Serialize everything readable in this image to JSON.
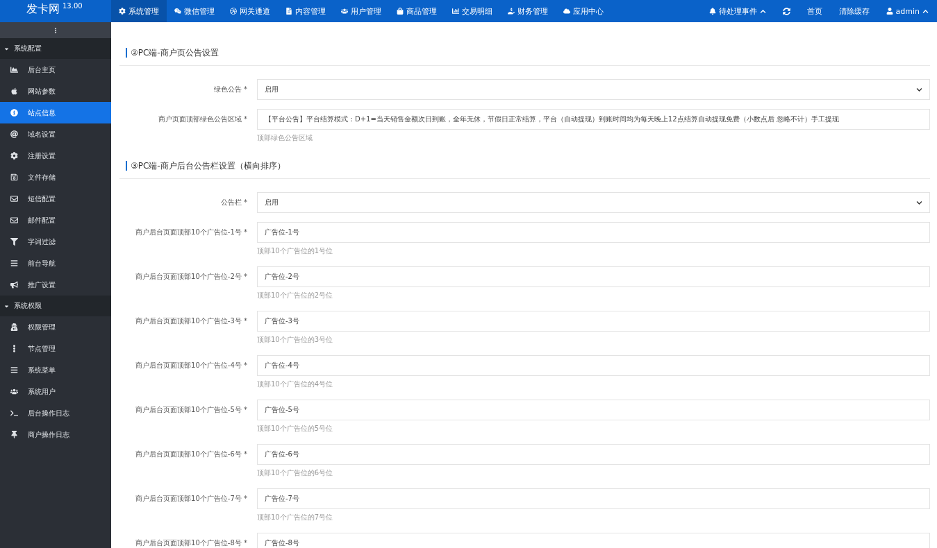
{
  "header": {
    "logo": "发卡网",
    "version": "13.00",
    "nav": [
      {
        "label": "系统管理",
        "selected": true
      },
      {
        "label": "微信管理",
        "selected": false
      },
      {
        "label": "网关通道",
        "selected": false
      },
      {
        "label": "内容管理",
        "selected": false
      },
      {
        "label": "用户管理",
        "selected": false
      },
      {
        "label": "商品管理",
        "selected": false
      },
      {
        "label": "交易明细",
        "selected": false
      },
      {
        "label": "财务管理",
        "selected": false
      },
      {
        "label": "应用中心",
        "selected": false
      }
    ],
    "pending": "待处理事件",
    "home": "首页",
    "clear_cache": "清除缓存",
    "user": "admin"
  },
  "sidebar": {
    "groups": [
      {
        "title": "系统配置",
        "expanded": true,
        "items": [
          {
            "label": "后台主页",
            "selected": false
          },
          {
            "label": "网站参数",
            "selected": false
          },
          {
            "label": "站点信息",
            "selected": true
          },
          {
            "label": "域名设置",
            "selected": false
          },
          {
            "label": "注册设置",
            "selected": false
          },
          {
            "label": "文件存储",
            "selected": false
          },
          {
            "label": "短信配置",
            "selected": false
          },
          {
            "label": "邮件配置",
            "selected": false
          },
          {
            "label": "字词过滤",
            "selected": false
          },
          {
            "label": "前台导航",
            "selected": false
          },
          {
            "label": "推广设置",
            "selected": false
          }
        ]
      },
      {
        "title": "系统权限",
        "expanded": true,
        "items": [
          {
            "label": "权限管理",
            "selected": false
          },
          {
            "label": "节点管理",
            "selected": false
          },
          {
            "label": "系统菜单",
            "selected": false
          },
          {
            "label": "系统用户",
            "selected": false
          },
          {
            "label": "后台操作日志",
            "selected": false
          },
          {
            "label": "商户操作日志",
            "selected": false
          }
        ]
      }
    ]
  },
  "sections": [
    {
      "title": "②PC端-商户页公告设置",
      "fields": [
        {
          "kind": "select",
          "label": "绿色公告",
          "mark": "*",
          "value": "启用"
        },
        {
          "kind": "input",
          "label": "商户页面顶部绿色公告区域",
          "mark": "*",
          "value": "【平台公告】平台结算模式：D+1=当天销售金额次日到账，全年无休，节假日正常结算，平台（自动提现）到账时间均为每天晚上12点结算自动提现免费（小数点后 忽略不计）手工提现",
          "hint": "顶部绿色公告区域"
        }
      ]
    },
    {
      "title": "③PC端-商户后台公告栏设置（横向排序）",
      "fields": [
        {
          "kind": "select",
          "label": "公告栏",
          "mark": "*",
          "value": "启用"
        },
        {
          "kind": "input",
          "label": "商户后台页面顶部10个广告位-1号",
          "mark": "*",
          "value": "广告位-1号",
          "hint": "顶部10个广告位的1号位"
        },
        {
          "kind": "input",
          "label": "商户后台页面顶部10个广告位-2号",
          "mark": "*",
          "value": "广告位-2号",
          "hint": "顶部10个广告位的2号位"
        },
        {
          "kind": "input",
          "label": "商户后台页面顶部10个广告位-3号",
          "mark": "*",
          "value": "广告位-3号",
          "hint": "顶部10个广告位的3号位"
        },
        {
          "kind": "input",
          "label": "商户后台页面顶部10个广告位-4号",
          "mark": "*",
          "value": "广告位-4号",
          "hint": "顶部10个广告位的4号位"
        },
        {
          "kind": "input",
          "label": "商户后台页面顶部10个广告位-5号",
          "mark": "*",
          "value": "广告位-5号",
          "hint": "顶部10个广告位的5号位"
        },
        {
          "kind": "input",
          "label": "商户后台页面顶部10个广告位-6号",
          "mark": "*",
          "value": "广告位-6号",
          "hint": "顶部10个广告位的6号位"
        },
        {
          "kind": "input",
          "label": "商户后台页面顶部10个广告位-7号",
          "mark": "*",
          "value": "广告位-7号",
          "hint": "顶部10个广告位的7号位"
        },
        {
          "kind": "input",
          "label": "商户后台页面顶部10个广告位-8号",
          "mark": "*",
          "value": "广告位-8号"
        }
      ]
    }
  ]
}
